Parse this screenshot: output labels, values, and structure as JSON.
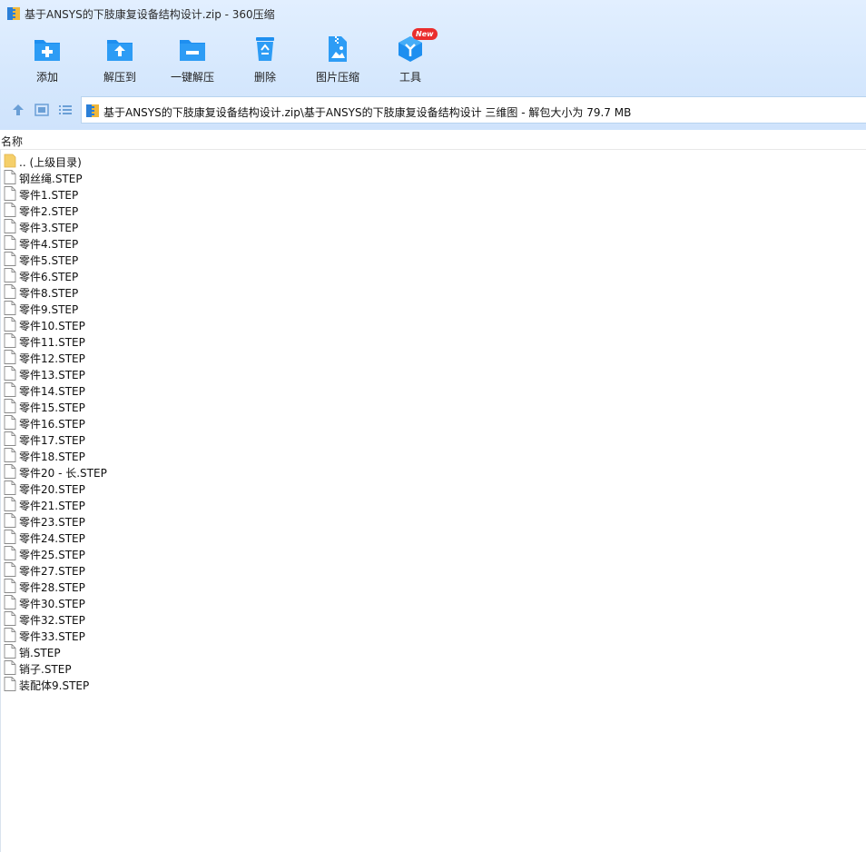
{
  "window": {
    "title": "基于ANSYS的下肢康复设备结构设计.zip - 360压缩"
  },
  "toolbar": {
    "items": [
      {
        "label": "添加",
        "icon": "add-folder-icon"
      },
      {
        "label": "解压到",
        "icon": "extract-to-icon"
      },
      {
        "label": "一键解压",
        "icon": "one-click-extract-icon"
      },
      {
        "label": "删除",
        "icon": "recycle-bin-icon"
      },
      {
        "label": "图片压缩",
        "icon": "image-compress-icon"
      },
      {
        "label": "工具",
        "icon": "tools-icon",
        "badge": "New"
      }
    ]
  },
  "address": {
    "path": "基于ANSYS的下肢康复设备结构设计.zip\\基于ANSYS的下肢康复设备结构设计 三维图 - 解包大小为 79.7 MB"
  },
  "list": {
    "column_name": "名称",
    "parent": ".. (上级目录)",
    "files": [
      "钢丝绳.STEP",
      "零件1.STEP",
      "零件2.STEP",
      "零件3.STEP",
      "零件4.STEP",
      "零件5.STEP",
      "零件6.STEP",
      "零件8.STEP",
      "零件9.STEP",
      "零件10.STEP",
      "零件11.STEP",
      "零件12.STEP",
      "零件13.STEP",
      "零件14.STEP",
      "零件15.STEP",
      "零件16.STEP",
      "零件17.STEP",
      "零件18.STEP",
      "零件20 - 长.STEP",
      "零件20.STEP",
      "零件21.STEP",
      "零件23.STEP",
      "零件24.STEP",
      "零件25.STEP",
      "零件27.STEP",
      "零件28.STEP",
      "零件30.STEP",
      "零件32.STEP",
      "零件33.STEP",
      "销.STEP",
      "销子.STEP",
      "装配体9.STEP"
    ]
  },
  "colors": {
    "accent": "#1e8ff0",
    "toolbar_bg": "#d6e8fd",
    "folder": "#f5cf6a",
    "badge": "#ea2d2d"
  }
}
